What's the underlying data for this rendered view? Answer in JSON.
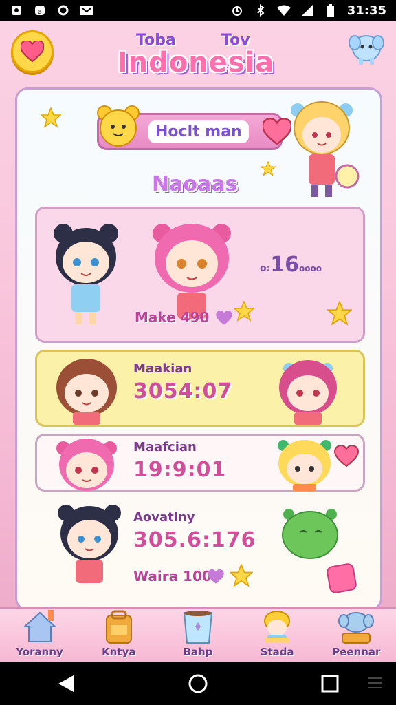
{
  "status_bar": {
    "time": "31:35",
    "icons": [
      "notification-icon",
      "app-icon",
      "sync-icon",
      "message-icon",
      "alarm-icon",
      "bluetooth-icon",
      "wifi-icon",
      "signal-icon",
      "battery-icon"
    ]
  },
  "header": {
    "title_small_left": "Toba",
    "title_small_right": "Tov",
    "title": "Indonesia",
    "heart_button_icon": "heart-icon",
    "mascot_icon": "elephant-icon"
  },
  "banner": {
    "label": "Hoclt man",
    "icon": "heart-icon"
  },
  "section": {
    "title": "Naoaas"
  },
  "cards": [
    {
      "label": "Make 490",
      "score": "16",
      "score_prefix": "o:",
      "score_suffix": "oooo"
    },
    {
      "name": "Maakian",
      "time": "3054:07"
    },
    {
      "name": "Maafcian",
      "time": "19:9:01"
    },
    {
      "name": "Aovatiny",
      "time": "305.6:176",
      "label": "Waira 100"
    }
  ],
  "bottom_nav": [
    {
      "label": "Yoranny",
      "icon": "home-icon"
    },
    {
      "label": "Kntya",
      "icon": "backpack-icon"
    },
    {
      "label": "Bahp",
      "icon": "cup-icon"
    },
    {
      "label": "Stada",
      "icon": "character-icon"
    },
    {
      "label": "Peennar",
      "icon": "elephant-icon"
    }
  ],
  "system_nav": [
    "back-icon",
    "home-circle-icon",
    "recents-icon",
    "menu-icon"
  ],
  "colors": {
    "accent_pink": "#ff6fae",
    "accent_purple": "#9f55c9",
    "star_yellow": "#ffd84a"
  }
}
